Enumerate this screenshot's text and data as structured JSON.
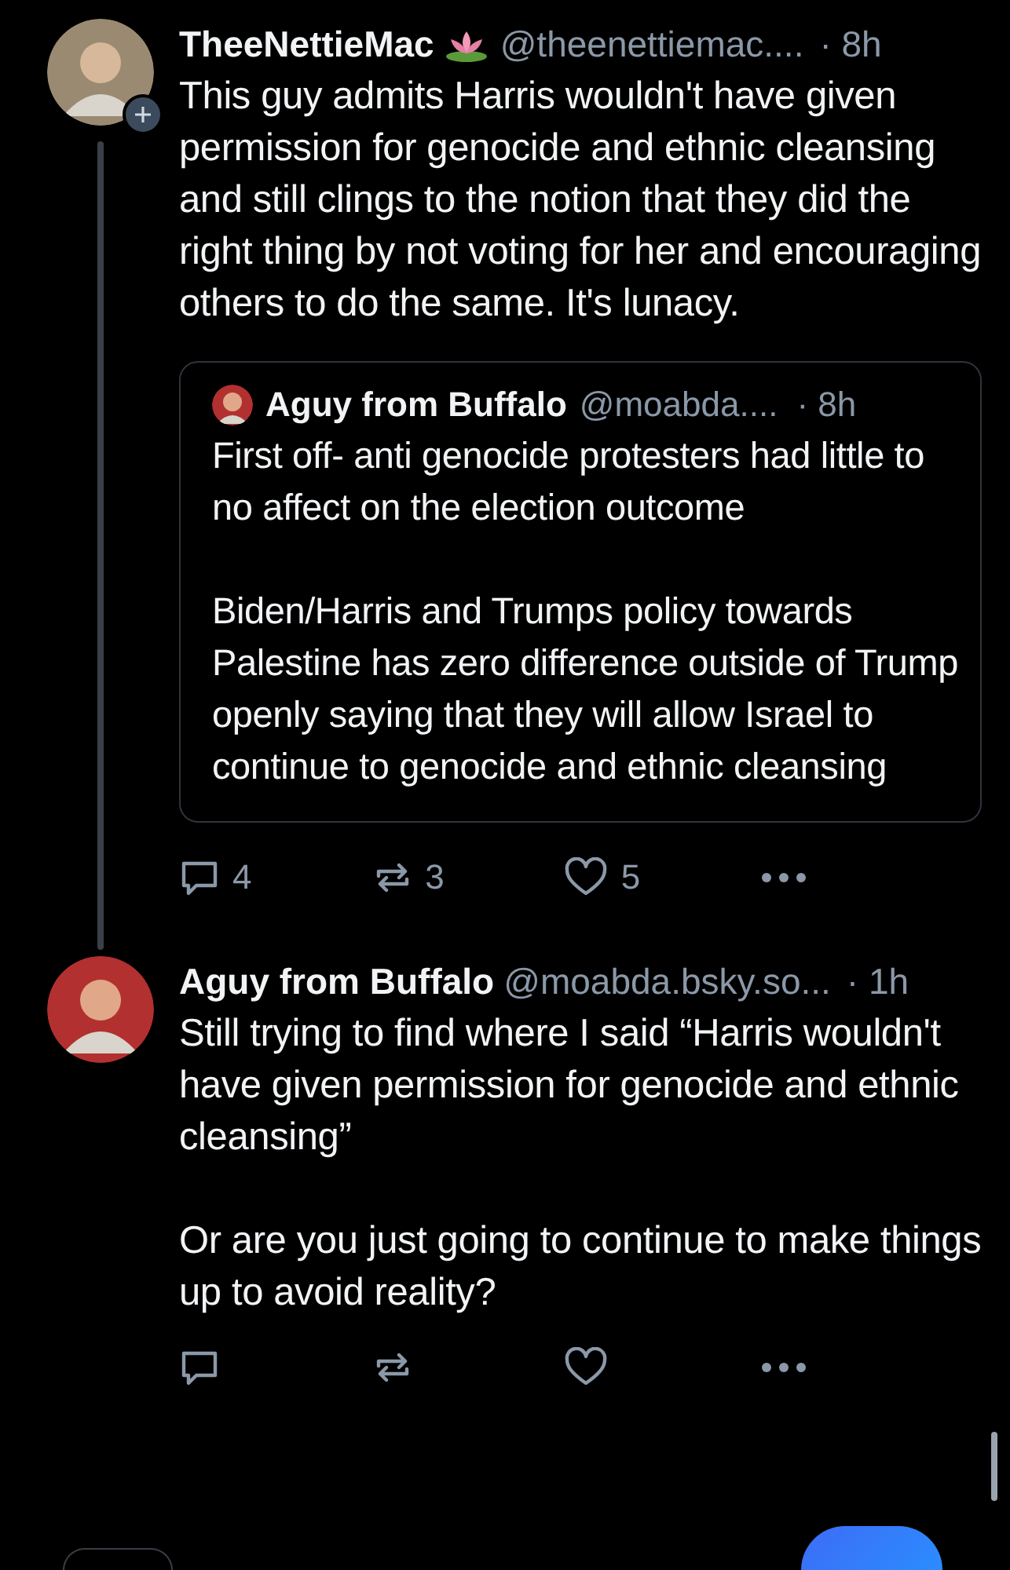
{
  "posts": [
    {
      "author": "TheeNettieMac",
      "handle": "@theenettiemac....",
      "time": "· 8h",
      "has_emoji": true,
      "follow_badge": true,
      "thread_line": true,
      "text": "This guy admits Harris wouldn't have given permission for  genocide and ethnic cleansing and still clings to the notion that they did the right thing by not voting for her and encouraging others to do the same. It's lunacy.",
      "quote": {
        "author": "Aguy from Buffalo",
        "handle": "@moabda....",
        "time": "· 8h",
        "text": "First off- anti genocide protesters had little to no affect on the election outcome\n\nBiden/Harris and Trumps policy towards Palestine has zero difference outside of Trump openly saying that they will allow Israel to continue to genocide and ethnic cleansing"
      },
      "actions": {
        "replies": "4",
        "reposts": "3",
        "likes": "5"
      }
    },
    {
      "author": "Aguy from Buffalo",
      "handle": "@moabda.bsky.so...",
      "time": "· 1h",
      "has_emoji": false,
      "follow_badge": false,
      "thread_line": false,
      "text": "Still trying to find where I said “Harris wouldn't have given permission for genocide and ethnic cleansing”\n\nOr are you just going to continue to make things up to avoid reality?"
    }
  ]
}
